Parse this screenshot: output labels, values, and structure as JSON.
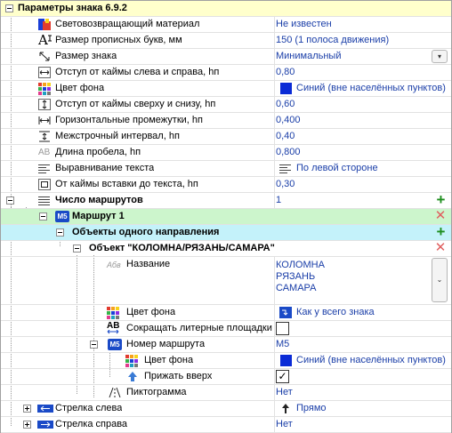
{
  "grid": {
    "header_label": "Параметры знака 6.9.2",
    "rows": {
      "retroreflective": {
        "label": "Световозвращающий материал",
        "value": "Не известен"
      },
      "cap_size": {
        "label": "Размер прописных букв, мм",
        "value": "150 (1 полоса движения)"
      },
      "sign_size": {
        "label": "Размер знака",
        "value": "Минимальный"
      },
      "margin_lr": {
        "label": "Отступ от каймы слева и справа, hп",
        "value": "0,80"
      },
      "bg_color": {
        "label": "Цвет фона",
        "value": "Синий (вне населённых пунктов)"
      },
      "margin_tb": {
        "label": "Отступ от каймы сверху и снизу, hп",
        "value": "0,60"
      },
      "h_gaps": {
        "label": "Горизонтальные промежутки, hп",
        "value": "0,400"
      },
      "line_spacing": {
        "label": "Межстрочный интервал, hп",
        "value": "0,40"
      },
      "space_len": {
        "label": "Длина пробела, hп",
        "value": "0,800"
      },
      "text_align": {
        "label": "Выравнивание текста",
        "value": "По левой стороне"
      },
      "insert_margin": {
        "label": "От каймы вставки до текста, hп",
        "value": "0,30"
      },
      "route_count": {
        "label": "Число маршрутов",
        "value": "1"
      },
      "route1": {
        "label": "Маршрут 1"
      },
      "one_direction": {
        "label": "Объекты одного направления"
      },
      "object": {
        "label": "Объект \"КОЛОМНА/РЯЗАНЬ/САМАРА\""
      },
      "name": {
        "label": "Название",
        "lines": [
          "КОЛОМНА",
          "РЯЗАНЬ",
          "САМАРА"
        ]
      },
      "obj_bg": {
        "label": "Цвет фона",
        "value": "Как у всего знака"
      },
      "shorten": {
        "label": "Сокращать литерные площадки"
      },
      "route_num": {
        "label": "Номер маршрута",
        "value": "M5"
      },
      "route_bg": {
        "label": "Цвет фона",
        "value": "Синий (вне населённых пунктов)"
      },
      "press_up": {
        "label": "Прижать вверх"
      },
      "pictogram": {
        "label": "Пиктограмма",
        "value": "Нет"
      },
      "arrow_left": {
        "label": "Стрелка слева",
        "value": "Прямо"
      },
      "arrow_right": {
        "label": "Стрелка справа",
        "value": "Нет"
      }
    },
    "badges": {
      "m5": "M5",
      "route_num_icon": "M5",
      "abc": "Абв",
      "ab": "AB",
      "font_a": "A"
    },
    "colors": {
      "header_bg": "#ffffcc",
      "route_bg": "#ccf5cc",
      "direction_bg": "#c4f2fa",
      "swatch_blue": "#0a2bd6",
      "value_text": "#1a3ea8"
    }
  }
}
